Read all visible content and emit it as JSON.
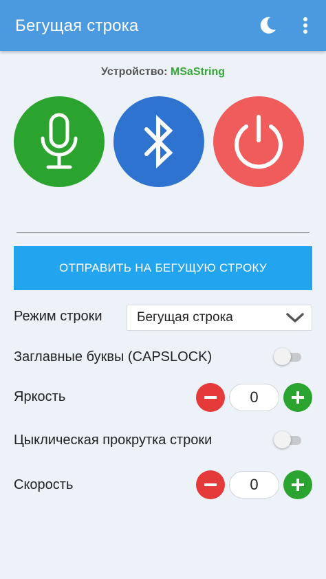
{
  "app": {
    "title": "Бегущая строка",
    "icons": {
      "night_mode": "moon-icon",
      "menu": "more-vert-icon"
    }
  },
  "device": {
    "label": "Устройство:",
    "name": "MSaString"
  },
  "actions": {
    "mic": {
      "icon": "microphone-icon",
      "color": "#2ba32f"
    },
    "bluetooth": {
      "icon": "bluetooth-icon",
      "color": "#2f73d0"
    },
    "power": {
      "icon": "power-icon",
      "color": "#f05c5c"
    }
  },
  "send_button": {
    "label": "ОТПРАВИТЬ НА БЕГУЩУЮ СТРОКУ",
    "color": "#23a4ee"
  },
  "settings": {
    "mode": {
      "label": "Режим строки",
      "selected": "Бегущая строка"
    },
    "capslock": {
      "label": "Заглавные буквы (CAPSLOCK)",
      "enabled": false
    },
    "brightness": {
      "label": "Яркость",
      "value": "0"
    },
    "loop": {
      "label": "Цыклическая прокрутка строки",
      "enabled": false
    },
    "speed": {
      "label": "Скорость",
      "value": "0"
    }
  },
  "colors": {
    "appbar": "#4b9ae0",
    "background": "#edf2f8",
    "accent_green": "#36a63a"
  }
}
